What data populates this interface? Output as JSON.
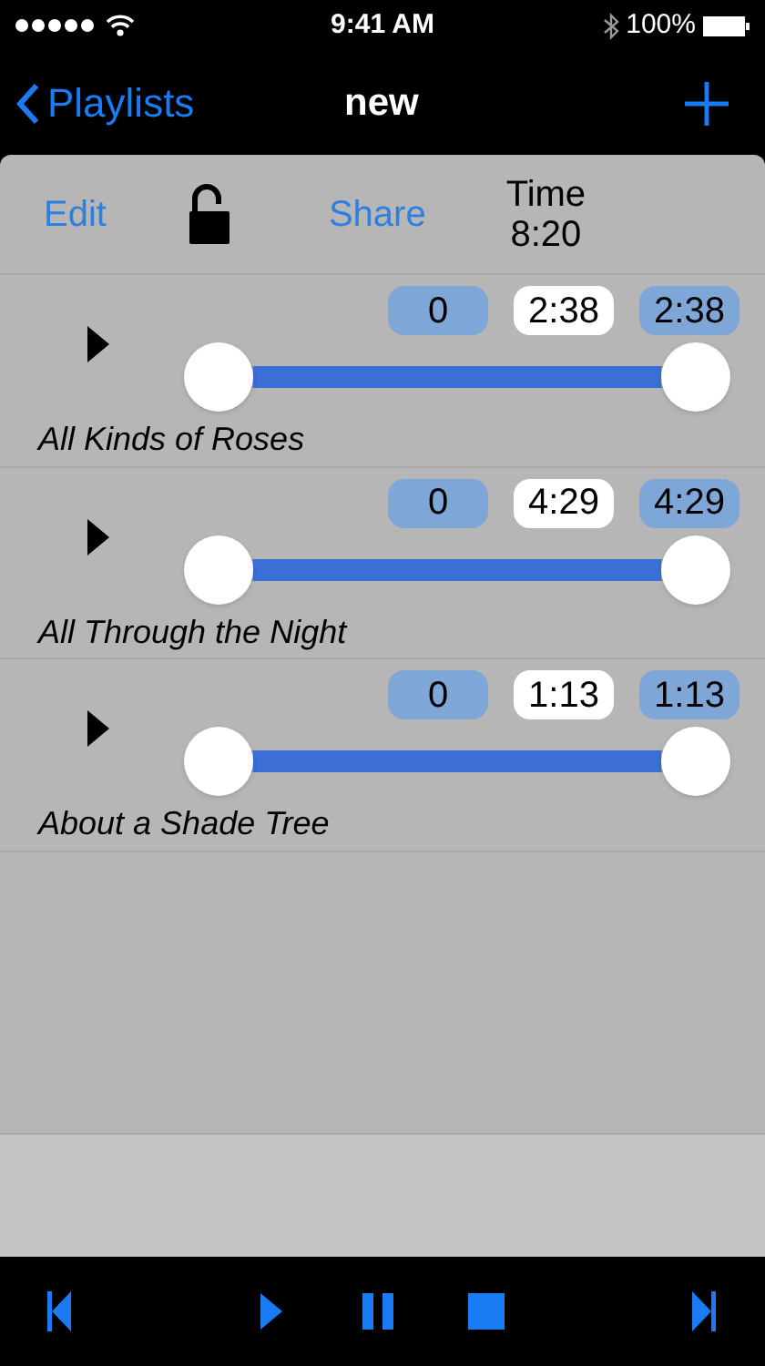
{
  "status_bar": {
    "time": "9:41 AM",
    "battery": "100%"
  },
  "nav": {
    "back": "Playlists",
    "title": "new"
  },
  "toolbar": {
    "edit": "Edit",
    "locked": false,
    "share": "Share",
    "time_label": "Time",
    "time_value": "8:20"
  },
  "tracks": [
    {
      "title": "All Kinds of Roses",
      "start": {
        "label": "0",
        "level": 0
      },
      "length": "2:38",
      "end": {
        "label": "2:38",
        "level": 1
      }
    },
    {
      "title": "All Through the Night",
      "start": {
        "label": "0",
        "level": 0
      },
      "length": "4:29",
      "end": {
        "label": "4:29",
        "level": 1
      }
    },
    {
      "title": "About a Shade Tree",
      "start": {
        "label": "0",
        "level": 0
      },
      "length": "1:13",
      "end": {
        "label": "1:13",
        "level": 1
      }
    }
  ]
}
